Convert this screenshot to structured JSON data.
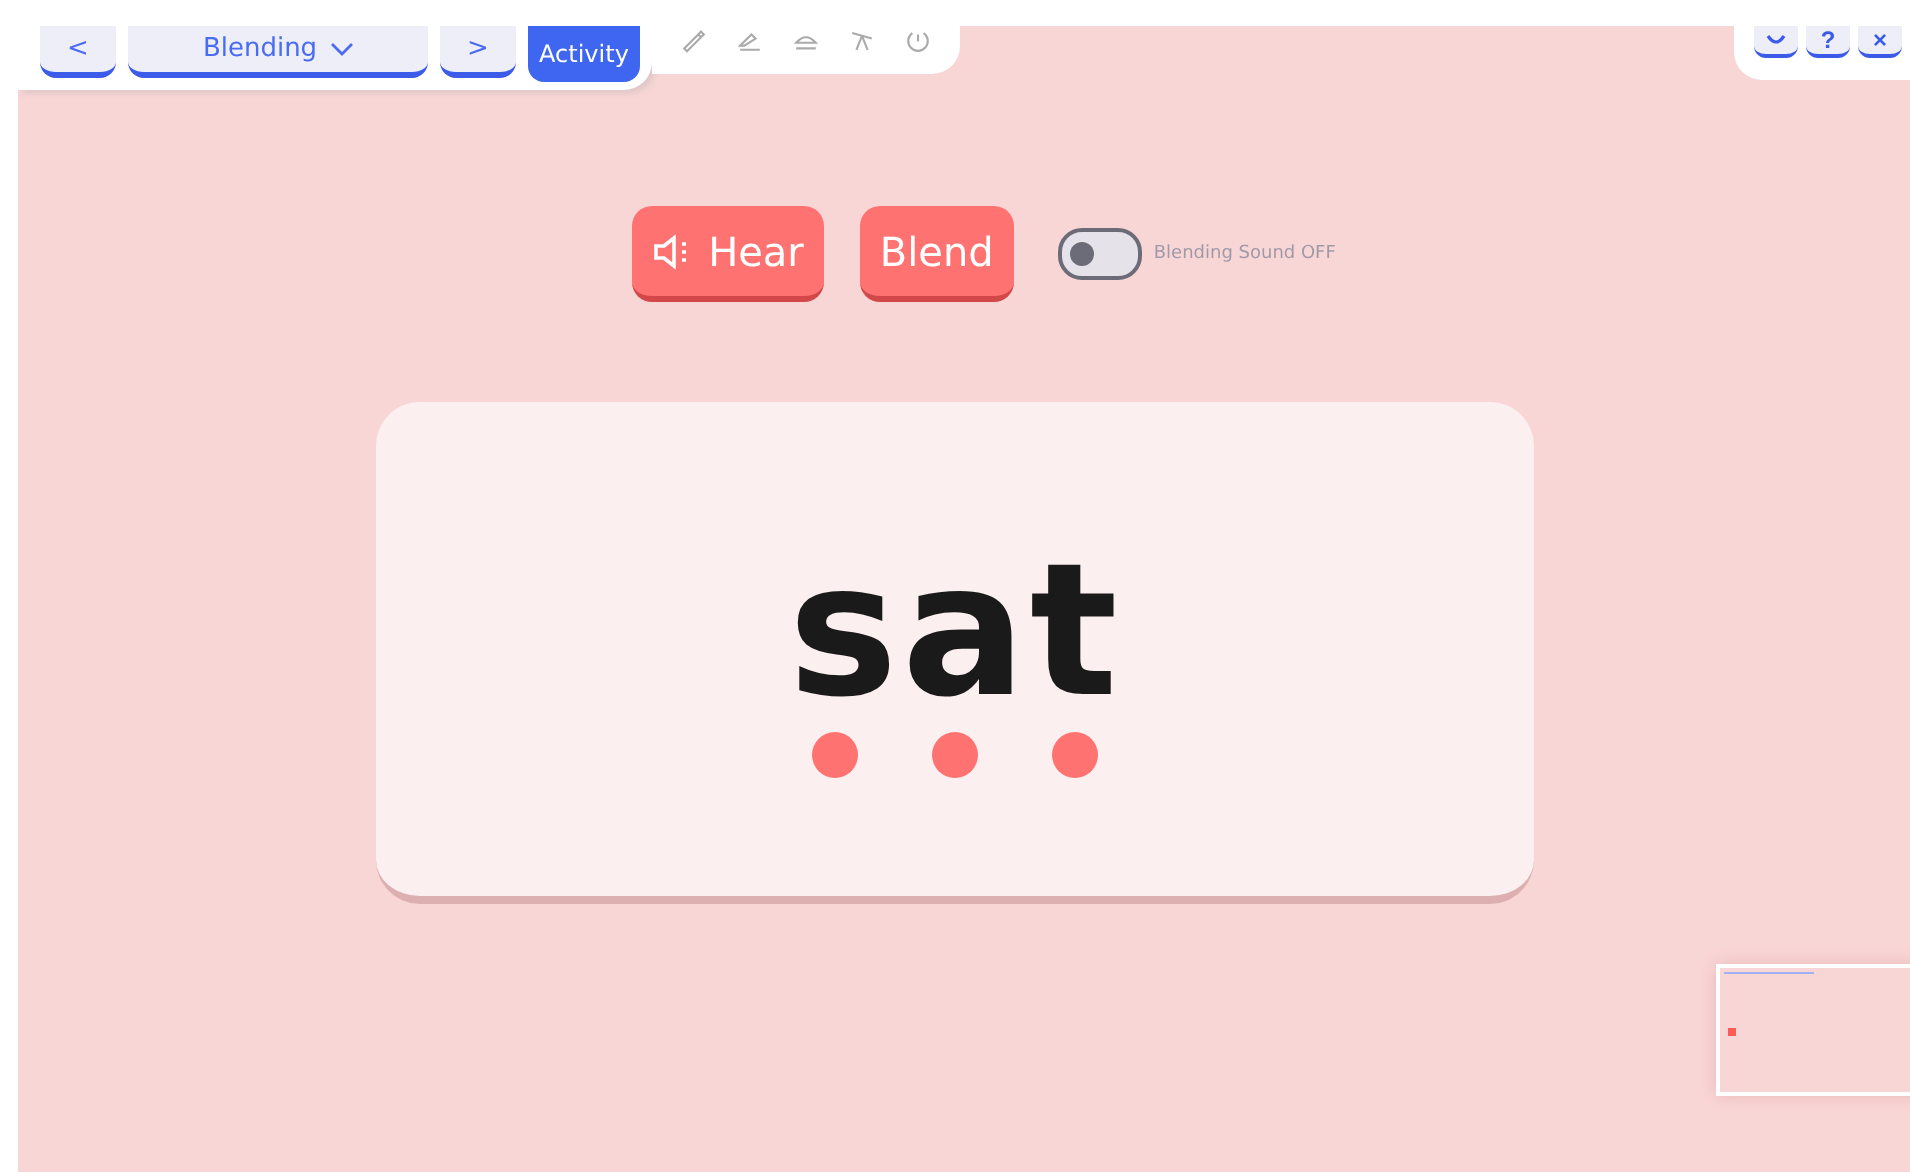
{
  "nav": {
    "prev": "<",
    "lesson": "Blending",
    "next": ">",
    "activity": "Activity"
  },
  "tools": [
    {
      "kind": "pen"
    },
    {
      "kind": "marker"
    },
    {
      "kind": "eraser"
    },
    {
      "kind": "pointer"
    },
    {
      "kind": "timer"
    }
  ],
  "corner_buttons": [
    {
      "kind": "smile"
    },
    {
      "kind": "help",
      "label": "?"
    },
    {
      "kind": "close",
      "label": "×"
    }
  ],
  "hear_button": "Hear",
  "blend_button": "Blend",
  "blending_sound": {
    "on": false,
    "label": "Blending Sound OFF"
  },
  "word": {
    "text": "sat",
    "sound_dots": [
      {
        "kind": "dot"
      },
      {
        "kind": "dot"
      },
      {
        "kind": "dot"
      }
    ]
  }
}
